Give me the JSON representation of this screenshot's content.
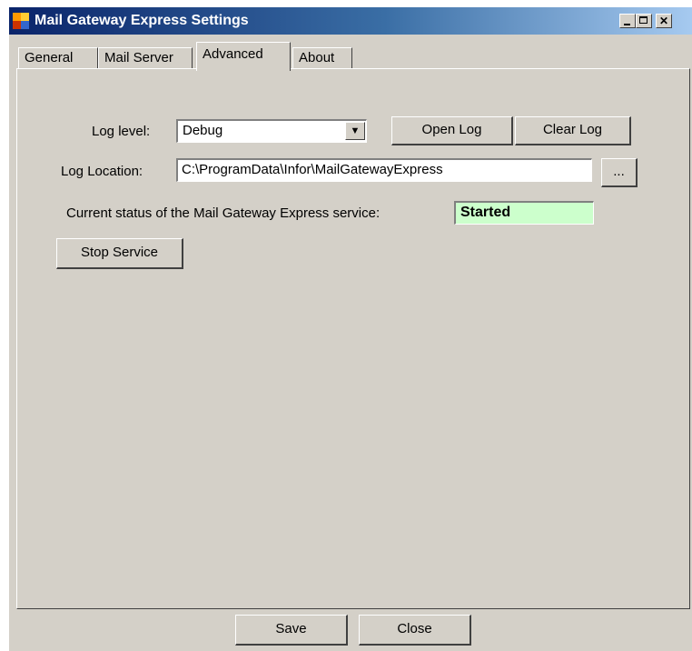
{
  "window": {
    "title": "Mail Gateway Express Settings"
  },
  "tabs": [
    {
      "label": "General"
    },
    {
      "label": "Mail Server"
    },
    {
      "label": "Advanced"
    },
    {
      "label": "About"
    }
  ],
  "advanced": {
    "log_level_label": "Log level:",
    "log_level_value": "Debug",
    "open_log_label": "Open Log",
    "clear_log_label": "Clear Log",
    "log_location_label": "Log Location:",
    "log_location_value": "C:\\ProgramData\\Infor\\MailGatewayExpress",
    "browse_label": "...",
    "status_label": "Current status of the Mail Gateway Express service:",
    "status_value": "Started",
    "stop_service_label": "Stop Service"
  },
  "footer": {
    "save_label": "Save",
    "close_label": "Close"
  },
  "colors": {
    "status_background": "#ccffcc",
    "window_background": "#d4d0c8",
    "titlebar_start": "#0a246a"
  }
}
